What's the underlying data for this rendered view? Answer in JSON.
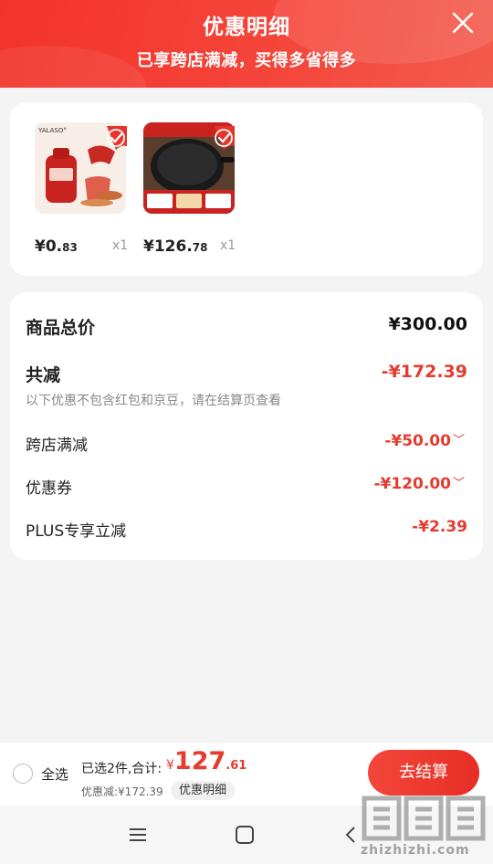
{
  "header": {
    "title": "优惠明细",
    "subtitle": "已享跨店满减，买得多省得多"
  },
  "products": [
    {
      "brand": "YALASO°",
      "price_int": "¥0.",
      "price_cents": "83",
      "qty": "x1",
      "image": "red-bottled-drink-product-icon"
    },
    {
      "price_int": "¥126.",
      "price_cents": "78",
      "qty": "x1",
      "image": "black-wok-pan-product-icon"
    }
  ],
  "summary": {
    "total_label": "商品总价",
    "total_value": "¥300.00",
    "reduce_label": "共减",
    "reduce_value": "-¥172.39",
    "note": "以下优惠不包含红包和京豆，请在结算页查看",
    "items": [
      {
        "label": "跨店满减",
        "value": "-¥50.00",
        "expandable": true
      },
      {
        "label": "优惠券",
        "value": "-¥120.00",
        "expandable": true
      },
      {
        "label": "PLUS专享立减",
        "value": "-¥2.39",
        "expandable": false
      }
    ]
  },
  "bottom": {
    "select_all": "全选",
    "selected_text": "已选2件,合计:",
    "yen": "¥",
    "total_int": "127",
    "total_cents": ".61",
    "discount_text": "优惠减:¥172.39",
    "detail_chip": "优惠明细",
    "checkout": "去结算"
  },
  "watermark": {
    "text": "zhizhizhi.com"
  },
  "colors": {
    "accent": "#e53b2f",
    "header": "#f2332b"
  }
}
